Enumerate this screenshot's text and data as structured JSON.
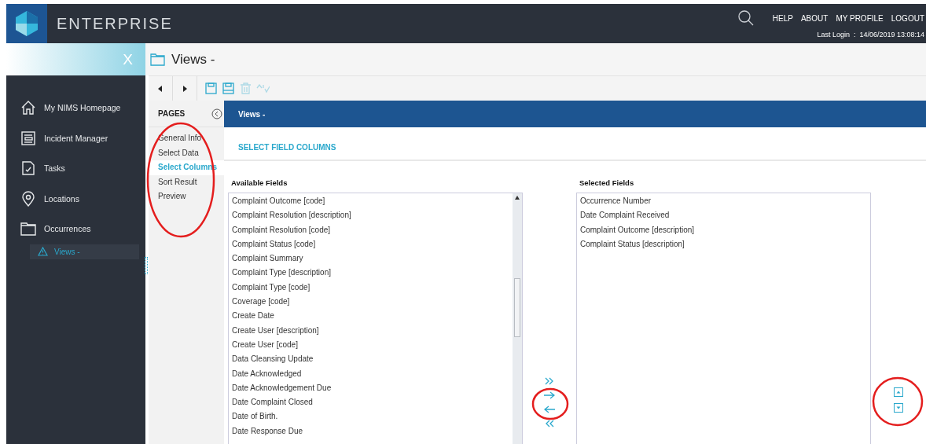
{
  "header": {
    "brand": "ENTERPRISE",
    "links": [
      "HELP",
      "ABOUT",
      "MY PROFILE",
      "LOGOUT"
    ],
    "last_login": "Last Login  :  14/06/2019 13:08:14"
  },
  "sidebar": {
    "close": "X",
    "items": [
      {
        "label": "My NIMS Homepage",
        "kind": "home"
      },
      {
        "label": "Incident Manager",
        "kind": "ledger"
      },
      {
        "label": "Tasks",
        "kind": "task"
      },
      {
        "label": "Locations",
        "kind": "pin"
      },
      {
        "label": "Occurrences",
        "kind": "folder",
        "children": [
          {
            "label": "Views -",
            "selected": true
          }
        ]
      }
    ]
  },
  "page_title": "Views -",
  "toolbar": [
    {
      "kind": "prev",
      "disabled": false
    },
    {
      "kind": "next",
      "disabled": false
    },
    {
      "kind": "save",
      "disabled": false
    },
    {
      "kind": "save-as",
      "disabled": false
    },
    {
      "kind": "delete",
      "disabled": true
    },
    {
      "kind": "spellcheck",
      "disabled": true
    }
  ],
  "pages": {
    "title": "PAGES",
    "items": [
      {
        "label": "General Info",
        "selected": false
      },
      {
        "label": "Select Data",
        "selected": false
      },
      {
        "label": "Select Columns",
        "selected": true
      },
      {
        "label": "Sort Result",
        "selected": false
      },
      {
        "label": "Preview",
        "selected": false
      }
    ]
  },
  "panel": {
    "title": "Views -",
    "section": "SELECT FIELD COLUMNS",
    "available": {
      "label": "Available Fields",
      "items": [
        "Complaint Outcome [code]",
        "Complaint Resolution [description]",
        "Complaint Resolution [code]",
        "Complaint Status [code]",
        "Complaint Summary",
        "Complaint Type [description]",
        "Complaint Type [code]",
        "Coverage [code]",
        "Create Date",
        "Create User [description]",
        "Create User [code]",
        "Data Cleansing Update",
        "Date Acknowledged",
        "Date Acknowledgement Due",
        "Date Complaint Closed",
        "Date of Birth.",
        "Date Response Due"
      ]
    },
    "selected": {
      "label": "Selected Fields",
      "items": [
        "Occurrence Number",
        "Date Complaint Received",
        "Complaint Outcome [description]",
        "Complaint Status [description]"
      ]
    }
  }
}
